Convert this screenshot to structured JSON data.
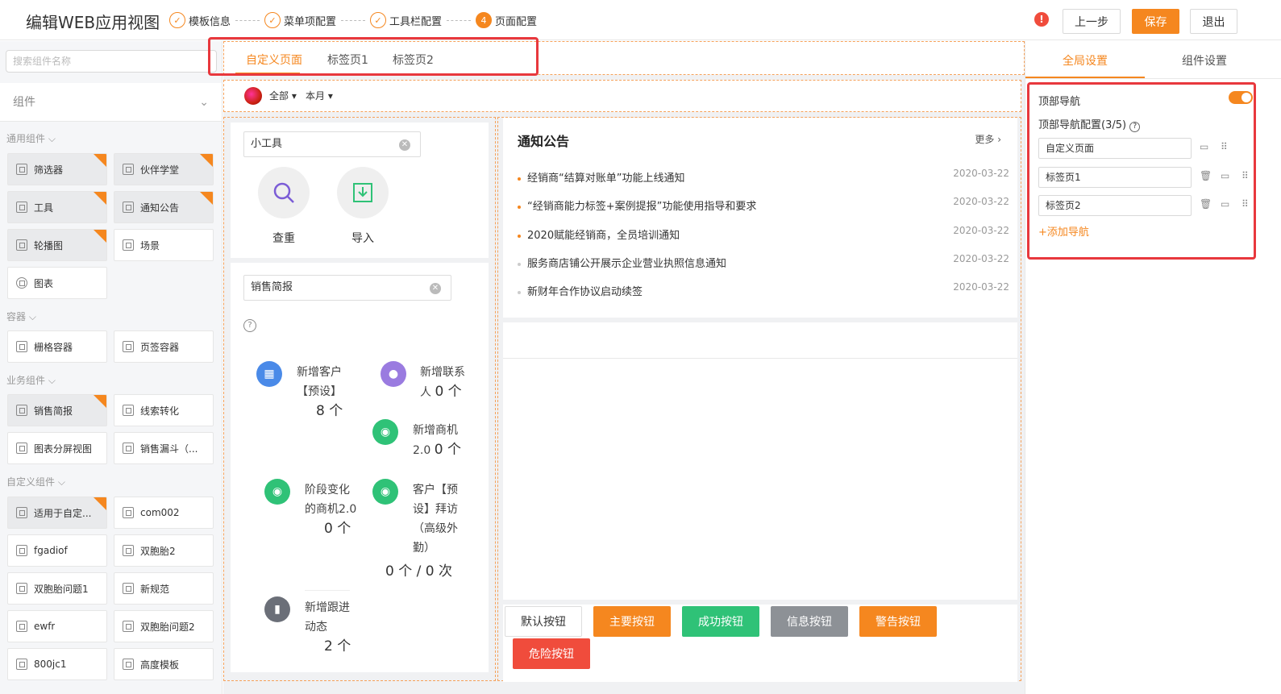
{
  "header": {
    "title": "编辑WEB应用视图",
    "steps": [
      {
        "label": "模板信息",
        "icon": "check-icon"
      },
      {
        "label": "菜单项配置",
        "icon": "check-icon"
      },
      {
        "label": "工具栏配置",
        "icon": "check-icon"
      },
      {
        "label": "页面配置",
        "num": "4"
      }
    ],
    "warn": "!",
    "prev_label": "上一步",
    "save_label": "保存",
    "exit_label": "退出"
  },
  "left": {
    "search_placeholder": "搜索组件名称",
    "section_title": "组件",
    "groups": [
      {
        "title": "通用组件",
        "items": [
          "筛选器",
          "伙伴学堂",
          "工具",
          "通知公告",
          "轮播图",
          "场景",
          "图表"
        ]
      },
      {
        "title": "容器",
        "items": [
          "栅格容器",
          "页签容器"
        ]
      },
      {
        "title": "业务组件",
        "items": [
          "销售简报",
          "线索转化",
          "图表分屏视图",
          "销售漏斗（..."
        ]
      },
      {
        "title": "自定义组件",
        "items": [
          "适用于自定...",
          "com002",
          "fgadiof",
          "双胞胎2",
          "双胞胎问题1",
          "新规范",
          "ewfr",
          "双胞胎问题2",
          "800jc1",
          "高度模板"
        ]
      }
    ]
  },
  "center": {
    "tabs": [
      "自定义页面",
      "标签页1",
      "标签页2"
    ],
    "filters": {
      "scope": "全部",
      "period": "本月"
    },
    "tools_card": {
      "title": "小工具",
      "tools": [
        {
          "label": "查重",
          "icon": "search-icon"
        },
        {
          "label": "导入",
          "icon": "import-icon"
        }
      ]
    },
    "sales_card": {
      "title": "销售简报",
      "metrics": [
        {
          "label1": "新增客户",
          "label2": "【预设】",
          "value": "8 个"
        },
        {
          "label1": "新增联系",
          "label2": "人",
          "value": "0 个"
        },
        {
          "label1": "新增商机",
          "label2": "2.0",
          "value": "0 个"
        },
        {
          "label1": "阶段变化",
          "label2": "的商机2.0",
          "value": "0 个"
        },
        {
          "label1": "客户【预",
          "label2": "设】拜访",
          "label3": "（高级外",
          "label4": "勤）",
          "value": "0 个 / 0 次"
        },
        {
          "label1": "新增跟进",
          "label2": "动态",
          "value": "2 个"
        }
      ]
    },
    "notice": {
      "title": "通知公告",
      "more": "更多",
      "items": [
        {
          "text": "经销商“结算对账单”功能上线通知",
          "date": "2020-03-22"
        },
        {
          "text": "“经销商能力标签+案例提报”功能使用指导和要求",
          "date": "2020-03-22"
        },
        {
          "text": "2020赋能经销商，全员培训通知",
          "date": "2020-03-22"
        },
        {
          "text": "服务商店铺公开展示企业营业执照信息通知",
          "date": "2020-03-22"
        },
        {
          "text": "新财年合作协议启动续签",
          "date": "2020-03-22"
        }
      ]
    },
    "buttons": [
      {
        "label": "默认按钮",
        "color": "#ffffff"
      },
      {
        "label": "主要按钮",
        "color": "#f5871f"
      },
      {
        "label": "成功按钮",
        "color": "#2fc277"
      },
      {
        "label": "信息按钮",
        "color": "#8d9196"
      },
      {
        "label": "警告按钮",
        "color": "#f5871f"
      },
      {
        "label": "危险按钮",
        "color": "#f04c3c"
      }
    ]
  },
  "right": {
    "tabs": [
      "全局设置",
      "组件设置"
    ],
    "topnav_label": "顶部导航",
    "topnav_enabled": true,
    "config_label": "顶部导航配置(3/5)",
    "nav_items": [
      "自定义页面",
      "标签页1",
      "标签页2"
    ],
    "add_label": "+添加导航"
  },
  "colors": {
    "accent": "#f5871f",
    "highlight": "#e8383d"
  }
}
